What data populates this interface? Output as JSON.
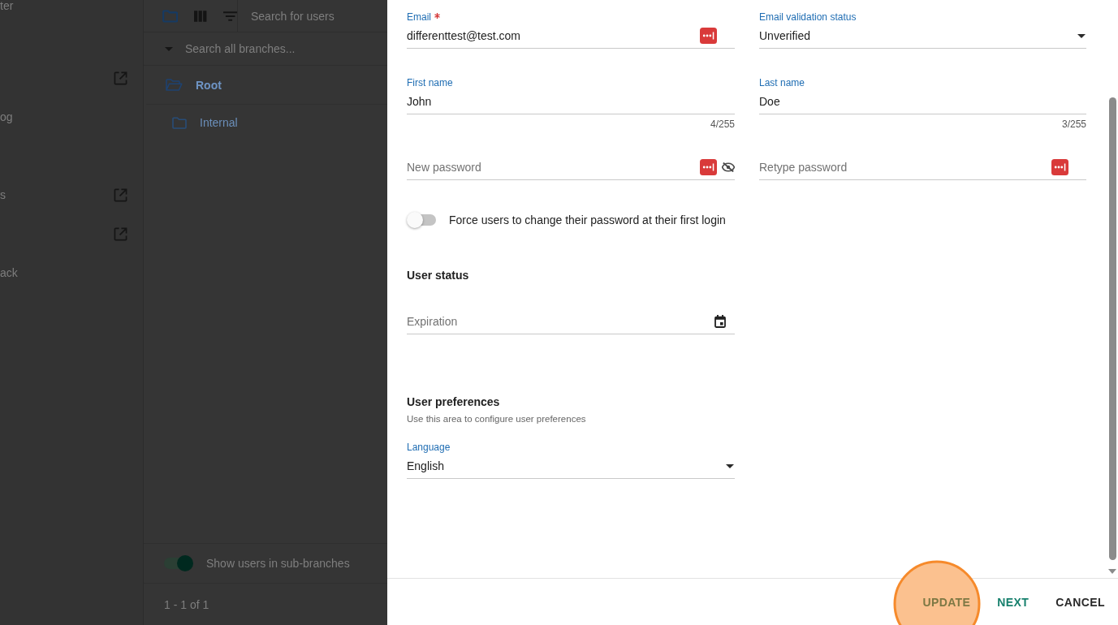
{
  "sidebar": {
    "items": [
      {
        "label": "ter",
        "external": false
      },
      {
        "external": true
      },
      {
        "label": "og",
        "external": false
      },
      {
        "label": "s",
        "external": true
      },
      {
        "external": true
      },
      {
        "label": "ack",
        "external": false
      }
    ]
  },
  "branches_panel": {
    "toolbar": {
      "buttons": [
        {
          "kind": "folder",
          "selected": true
        },
        {
          "kind": "columns",
          "selected": false
        },
        {
          "kind": "filter",
          "selected": false
        }
      ],
      "search": {
        "placeholder": "Search for users"
      }
    },
    "tree_search": {
      "placeholder": "Search all branches..."
    },
    "tree": [
      {
        "label": "Root",
        "selected": true,
        "expanded": true,
        "children": [
          {
            "label": "Internal",
            "selected": false,
            "expanded": false
          }
        ]
      }
    ],
    "sub_branches_toggle": {
      "label": "Show users in sub-branches",
      "on": true
    },
    "pagination": "1 - 1 of 1"
  },
  "dialog": {
    "fields": [
      {
        "kind": "text",
        "label": "Email",
        "required": true,
        "value": "differenttest@test.com",
        "password_manager": true,
        "visibility_toggle": false
      },
      {
        "kind": "select",
        "label": "Email validation status",
        "required": false,
        "value": "Unverified"
      },
      {
        "kind": "text",
        "label": "First name",
        "required": false,
        "value": "John",
        "counter": "4/255",
        "password_manager": false,
        "visibility_toggle": false
      },
      {
        "kind": "text",
        "label": "Last name",
        "required": false,
        "value": "Doe",
        "counter": "3/255",
        "password_manager": false,
        "visibility_toggle": false
      },
      {
        "kind": "password",
        "placeholder": "New password",
        "password_manager": true,
        "visibility_toggle": true
      },
      {
        "kind": "password",
        "placeholder": "Retype password",
        "password_manager": true,
        "visibility_toggle": false
      }
    ],
    "force_password_change": {
      "label": "Force users to change their password at their first login",
      "on": false
    },
    "sections": [
      {
        "heading": "User status",
        "fields": [
          {
            "kind": "date",
            "placeholder": "Expiration"
          }
        ]
      },
      {
        "heading": "User preferences",
        "description": "Use this area to configure user preferences",
        "fields": [
          {
            "kind": "select",
            "label": "Language",
            "required": false,
            "value": "English"
          }
        ]
      }
    ],
    "buttons": [
      {
        "label": "UPDATE",
        "kind": "primary",
        "highlighted": true
      },
      {
        "label": "NEXT",
        "kind": "primary",
        "highlighted": false
      },
      {
        "label": "CANCEL",
        "kind": "plain",
        "highlighted": false
      }
    ]
  }
}
